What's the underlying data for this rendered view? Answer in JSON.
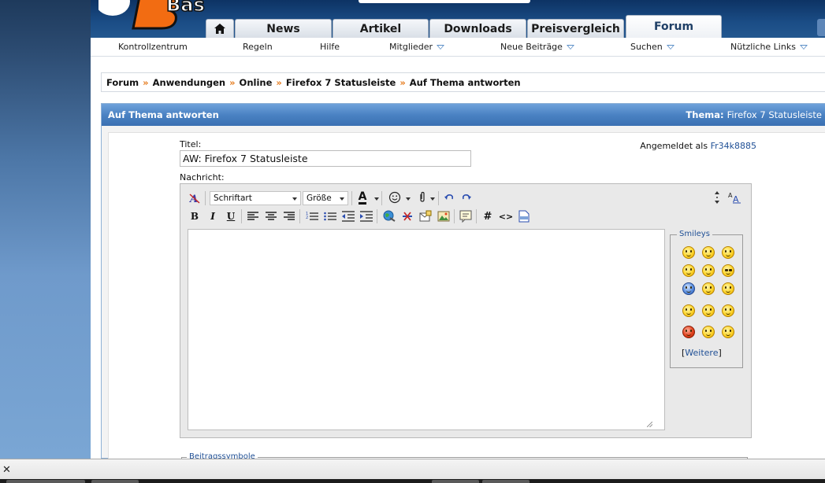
{
  "header": {
    "logo_text": "Base",
    "tabs": [
      {
        "label": "News"
      },
      {
        "label": "Artikel"
      },
      {
        "label": "Downloads"
      },
      {
        "label": "Preisvergleich"
      },
      {
        "label": "Forum",
        "active": true
      }
    ]
  },
  "navbar": {
    "items": [
      {
        "label": "Kontrollzentrum"
      },
      {
        "label": "Regeln"
      },
      {
        "label": "Hilfe"
      },
      {
        "label": "Mitglieder",
        "dropdown": true
      },
      {
        "label": "Neue Beiträge",
        "dropdown": true
      },
      {
        "label": "Suchen",
        "dropdown": true
      },
      {
        "label": "Nützliche Links",
        "dropdown": true
      }
    ]
  },
  "breadcrumb": [
    "Forum",
    "Anwendungen",
    "Online",
    "Firefox 7 Statusleiste",
    "Auf Thema antworten"
  ],
  "panel": {
    "title": "Auf Thema antworten",
    "thema_label": "Thema:",
    "thema_value": "Firefox 7 Statusleiste"
  },
  "form": {
    "title_label": "Titel:",
    "title_value": "AW: Firefox 7 Statusleiste",
    "message_label": "Nachricht:",
    "logged_in_label": "Angemeldet als",
    "username": "Fr34k8885"
  },
  "editor": {
    "font_select": "Schriftart",
    "size_select": "Größe",
    "bold_label": "B",
    "italic_label": "I",
    "underline_label": "U",
    "hash_label": "#",
    "code_label": "<>",
    "font_color_letter": "A",
    "message_value": ""
  },
  "smileys": {
    "legend": "Smileys",
    "more_label": "Weitere"
  },
  "beitragssymbole": {
    "legend": "Beitragssymbole"
  },
  "colors": {
    "header_bg": "#1b4d86",
    "panel_head": "#4a82c3",
    "breadcrumb_sep": "#e5791a",
    "link": "#1f4f95"
  }
}
